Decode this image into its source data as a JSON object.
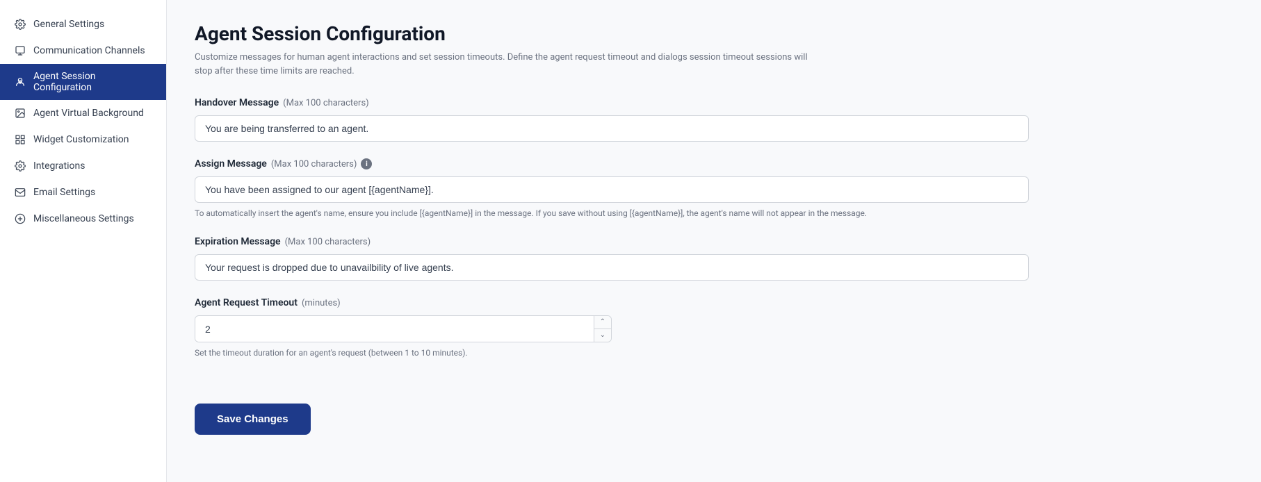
{
  "sidebar": {
    "items": [
      {
        "id": "general-settings",
        "label": "General Settings",
        "icon": "gear"
      },
      {
        "id": "communication-channels",
        "label": "Communication Channels",
        "icon": "chat"
      },
      {
        "id": "agent-session-configuration",
        "label": "Agent Session Configuration",
        "icon": "agent",
        "active": true
      },
      {
        "id": "agent-virtual-background",
        "label": "Agent Virtual Background",
        "icon": "image"
      },
      {
        "id": "widget-customization",
        "label": "Widget Customization",
        "icon": "user"
      },
      {
        "id": "integrations",
        "label": "Integrations",
        "icon": "gear2"
      },
      {
        "id": "email-settings",
        "label": "Email Settings",
        "icon": "email"
      },
      {
        "id": "miscellaneous-settings",
        "label": "Miscellaneous Settings",
        "icon": "plus-circle"
      }
    ]
  },
  "main": {
    "title": "Agent Session Configuration",
    "subtitle": "Customize messages for human agent interactions and set session timeouts. Define the agent request timeout and dialogs session timeout sessions will stop after these time limits are reached.",
    "sections": {
      "handover": {
        "label": "Handover Message",
        "max_chars": "(Max 100 characters)",
        "value": "You are being transferred to an agent.",
        "placeholder": "You are being transferred to an agent."
      },
      "assign": {
        "label": "Assign Message",
        "max_chars": "(Max 100 characters)",
        "value": "You have been assigned to our agent [{agentName}].",
        "placeholder": "You have been assigned to our agent [{agentName}].",
        "hint": "To automatically insert the agent's name, ensure you include [{agentName}] in the message. If you save without using [{agentName}], the agent's name will not appear in the message.",
        "has_info": true
      },
      "expiration": {
        "label": "Expiration Message",
        "max_chars": "(Max 100 characters)",
        "value": "Your request is dropped due to unavailbility of live agents.",
        "placeholder": "Your request is dropped due to unavailbility of live agents."
      },
      "timeout": {
        "label": "Agent Request Timeout",
        "unit": "(minutes)",
        "value": "2",
        "hint": "Set the timeout duration for an agent's request (between 1 to 10 minutes)."
      }
    },
    "save_button": "Save Changes"
  }
}
